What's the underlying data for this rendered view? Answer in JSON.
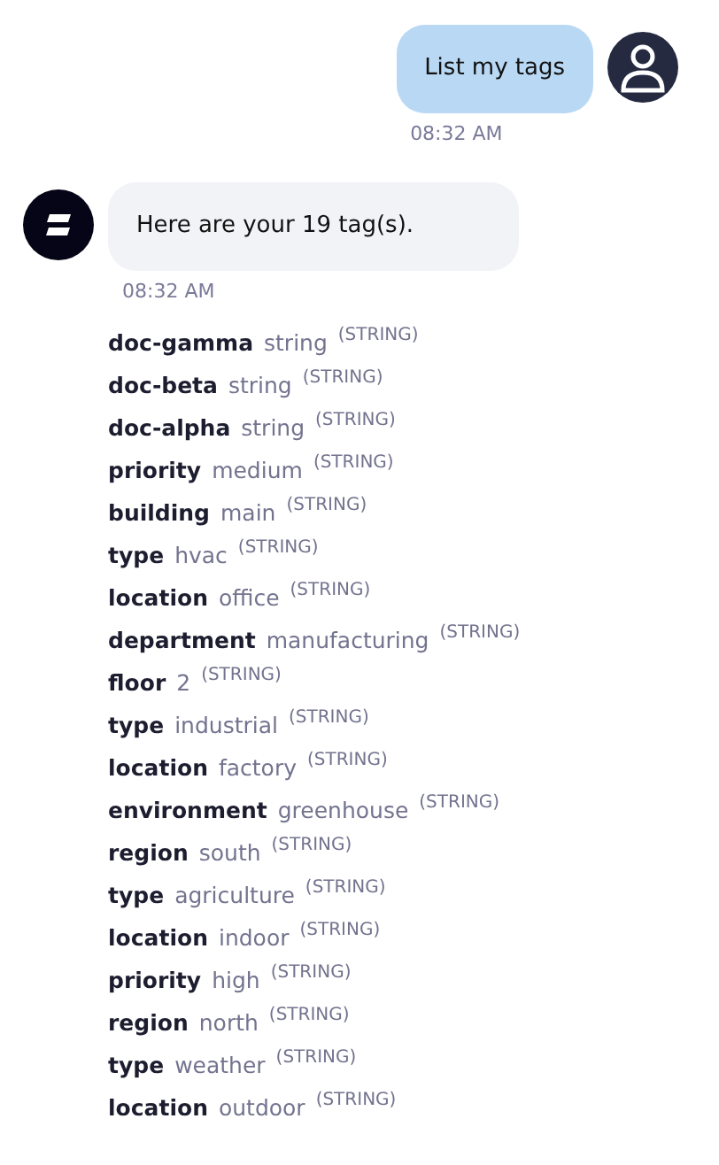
{
  "messages": [
    {
      "kind": "user",
      "text": "List my tags",
      "time": "08:32 AM"
    },
    {
      "kind": "bot",
      "text": "Here are your 19 tag(s).",
      "time": "08:32 AM"
    }
  ],
  "tags": [
    {
      "key": "doc-gamma",
      "value": "string",
      "type": "(STRING)"
    },
    {
      "key": "doc-beta",
      "value": "string",
      "type": "(STRING)"
    },
    {
      "key": "doc-alpha",
      "value": "string",
      "type": "(STRING)"
    },
    {
      "key": "priority",
      "value": "medium",
      "type": "(STRING)"
    },
    {
      "key": "building",
      "value": "main",
      "type": "(STRING)"
    },
    {
      "key": "type",
      "value": "hvac",
      "type": "(STRING)"
    },
    {
      "key": "location",
      "value": "office",
      "type": "(STRING)"
    },
    {
      "key": "department",
      "value": "manufacturing",
      "type": "(STRING)"
    },
    {
      "key": "floor",
      "value": "2",
      "type": "(STRING)"
    },
    {
      "key": "type",
      "value": "industrial",
      "type": "(STRING)"
    },
    {
      "key": "location",
      "value": "factory",
      "type": "(STRING)"
    },
    {
      "key": "environment",
      "value": "greenhouse",
      "type": "(STRING)"
    },
    {
      "key": "region",
      "value": "south",
      "type": "(STRING)"
    },
    {
      "key": "type",
      "value": "agriculture",
      "type": "(STRING)"
    },
    {
      "key": "location",
      "value": "indoor",
      "type": "(STRING)"
    },
    {
      "key": "priority",
      "value": "high",
      "type": "(STRING)"
    },
    {
      "key": "region",
      "value": "north",
      "type": "(STRING)"
    },
    {
      "key": "type",
      "value": "weather",
      "type": "(STRING)"
    },
    {
      "key": "location",
      "value": "outdoor",
      "type": "(STRING)"
    }
  ]
}
